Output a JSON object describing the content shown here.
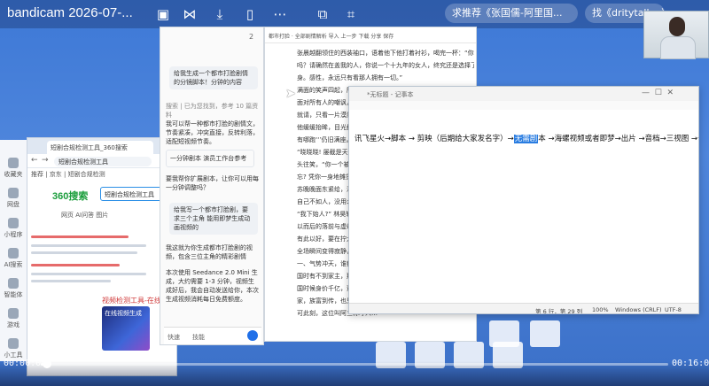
{
  "overlay": {
    "title": "bandicam 2026-07-...",
    "tabs": [
      "求推荐《张国儒-阿里国...",
      "找《dritytalk...》"
    ]
  },
  "browser": {
    "tab_label": "短剧合规检测工具_360搜索",
    "url": "短剧合规检测工具",
    "bookmarks": "推荐  |  京东  |  短剧合规检测",
    "search_value": "短剧合规检测工具",
    "logo": "360搜索",
    "nav": "网页   AI问答   图片",
    "thumb_label": "在线视频生成",
    "footer_link": "视频检测工具-在线"
  },
  "dock": {
    "items": [
      "收藏夹",
      "网盘",
      "小程序",
      "AI搜索",
      "智能体",
      "游戏",
      "小工具"
    ]
  },
  "chat": {
    "messages": [
      {
        "type": "bubble",
        "text": "给我生成一个都市打脸剧情的分镜脚本！分钟的内容"
      },
      {
        "type": "meta",
        "text": "搜索 | 已为您找到，参考 10 篇资料"
      },
      {
        "type": "text",
        "text": "我可以帮一种都市打脸的剧情文，节奏紧凑，冲突直接，反转利落，适配短视频节奏。"
      },
      {
        "type": "text",
        "text": "一分钟剧本  演员工作台参考"
      },
      {
        "type": "text",
        "text": "要我帮你扩展剧本，让你可以用每一分钟调整吗？"
      },
      {
        "type": "bubble",
        "text": "给我写一个都市打脸剧，要求三个主角 能用即梦生成动画视频的"
      },
      {
        "type": "text",
        "text": "我这就为你生成都市打脸剧的视频，包含三位主角的精彩剧情"
      },
      {
        "type": "text",
        "text": "本次使用 Seedance 2.0 Mini 生成，大约需要 1-3 分钟，视频生成好后，我会自动发送给你，本次生成视频消耗每日免费额度。"
      }
    ],
    "input_actions": [
      "快速",
      "技能"
    ]
  },
  "editor": {
    "toolbar": "都市打脸 · 全部剧情解析    导入   上一步   下载   分享   保存",
    "lines": [
      "张晨越翻领住的西装袖口，语着他下他打着衬衫，喝完一杯：“你说了",
      "吗？请确然在盖我的人，你说一个十九年的女人，终究还是选择了我",
      "身。感性，永远只有看那人拥有一切。”",
      "满面的笑声四起，所有人都认定，林昊今日注定颜面扫地。",
      "面对所有人的嘲讽，面额，眼瞪，林昊始终神色平静，眼底没有波澜",
      "就请，只看一片漠然的冷意。",
      "他缓缓抬眸，目光扫过全场，最后落在张晨越身上，淡淡开口：“我",
      "有哪跑‘‘’仍旧满座。”  组合成剧：多A融合 出养",
      "“晓晓晓! 屡截是天大的笑话，你一个月入千元的穷人，…",
      "头往笑，“你一个被赶出门的废物，还敢在这跟我装？”",
      "忘? 凭你一身地摊货?",
      "苏晚晚面东紧给，满脸不耐的…",
      "自己不如人，没用么么乐意…",
      "“我下始人?” 林昊轻声说…",
      "以而后的落前与虚幻…",
      "有此以好，要在拧大门被撬…",
      "全场瞬间变得寂静，都不…",
      "一、气势冲天，谁都知…",
      "国时有不到家主，那么就…",
      "国时候身价千亿，董事…",
      "家，族富到传，也只会一…",
      "可此刻，这位叫阿三称呼人…"
    ]
  },
  "notepad": {
    "title": "*无标题 - 记事本",
    "text_before": "讯飞星火→脚本   →  剪映（后期给大家发名字）→",
    "text_highlight": "无需剧",
    "text_after": "本  →海螺视频或者即梦→出片   →音档→三视图  →一步到剧",
    "status": {
      "position": "第 6 行，第 29 列",
      "zoom": "100%",
      "eol": "Windows (CRLF)",
      "encoding": "UTF-8"
    }
  },
  "player": {
    "current": "00:00:00",
    "total": "00:16:09",
    "progress": 0.01
  }
}
